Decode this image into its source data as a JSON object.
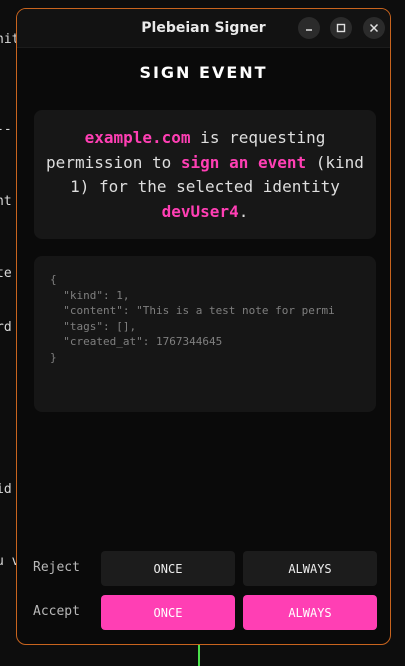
{
  "background_terminal": {
    "lines": [
      {
        "text": "nit"
      },
      {
        "text": "--"
      },
      {
        "text": "nt"
      },
      {
        "text": "te"
      },
      {
        "text": "rd"
      },
      {
        "text": "id"
      },
      {
        "text": "u v"
      }
    ]
  },
  "window": {
    "title": "Plebeian Signer",
    "controls": {
      "minimize_icon": "minimize-icon",
      "maximize_icon": "maximize-icon",
      "close_icon": "close-icon"
    }
  },
  "page": {
    "heading": "SIGN EVENT"
  },
  "request": {
    "domain": "example.com",
    "text_1": " is requesting permission to ",
    "action": "sign an event",
    "text_2": " (kind 1) for the selected identity ",
    "identity": "devUser4",
    "text_3": "."
  },
  "event_json": {
    "lines": [
      "{",
      "  \"kind\": 1,",
      "  \"content\": \"This is a test note for permi",
      "  \"tags\": [],",
      "  \"created_at\": 1767344645",
      "}"
    ]
  },
  "actions": {
    "reject": {
      "label": "Reject",
      "once": "ONCE",
      "always": "ALWAYS"
    },
    "accept": {
      "label": "Accept",
      "once": "ONCE",
      "always": "ALWAYS"
    }
  },
  "colors": {
    "accent": "#ff3fb4",
    "window_border": "#c8641e",
    "background": "#0a0a0a"
  }
}
